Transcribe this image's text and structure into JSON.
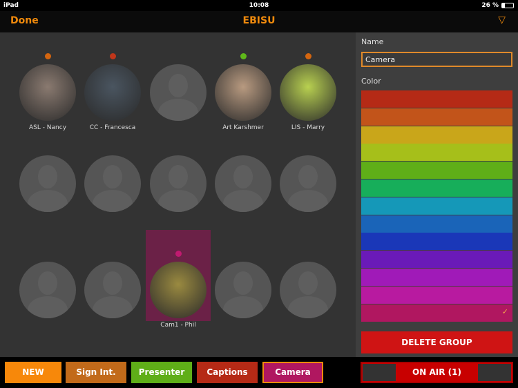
{
  "status": {
    "device": "iPad",
    "time": "10:08",
    "battery": "26 %"
  },
  "nav": {
    "done": "Done",
    "title": "EBISU",
    "menu_icon": "triangle-down-icon"
  },
  "grid": [
    {
      "label": "ASL - Nancy",
      "dot": "#d4650f",
      "photo": true,
      "tint": "#8a7a70"
    },
    {
      "label": "CC - Francesca",
      "dot": "#c0361a",
      "photo": true,
      "tint": "#4a5560"
    },
    {
      "label": "",
      "dot": null
    },
    {
      "label": "Art Karshmer",
      "dot": "#5fb81a",
      "photo": true,
      "tint": "#b89a80"
    },
    {
      "label": "LIS - Marry",
      "dot": "#d4650f",
      "photo": true,
      "tint": "#b8d050"
    },
    {
      "label": "",
      "dot": null
    },
    {
      "label": "",
      "dot": null
    },
    {
      "label": "",
      "dot": null
    },
    {
      "label": "",
      "dot": null
    },
    {
      "label": "",
      "dot": null
    },
    {
      "label": "",
      "dot": null
    },
    {
      "label": "",
      "dot": null
    },
    {
      "label": "Cam1 - Phil",
      "dot": "#c01a70",
      "photo": true,
      "tint": "#9a8a40",
      "selected": true
    },
    {
      "label": "",
      "dot": null
    },
    {
      "label": "",
      "dot": null
    }
  ],
  "side": {
    "name_label": "Name",
    "name_value": "Camera",
    "color_label": "Color",
    "colors": [
      "#b52a16",
      "#c2541a",
      "#c9a61a",
      "#a6bf1a",
      "#5fae18",
      "#17ae5a",
      "#1598b8",
      "#1a64b8",
      "#1a37b8",
      "#6a1ab8",
      "#a01ab8",
      "#b81aa0",
      "#b01760"
    ],
    "selected_color_index": 12,
    "check": "✓",
    "delete": "DELETE GROUP"
  },
  "groups": [
    {
      "label": "NEW",
      "color": "#f7880a"
    },
    {
      "label": "Sign Int.",
      "color": "#c26a1a"
    },
    {
      "label": "Presenter",
      "color": "#5fae18"
    },
    {
      "label": "Captions",
      "color": "#b52a16"
    },
    {
      "label": "Camera",
      "color": "#b01760",
      "selected": true
    }
  ],
  "onair": "ON AIR (1)"
}
